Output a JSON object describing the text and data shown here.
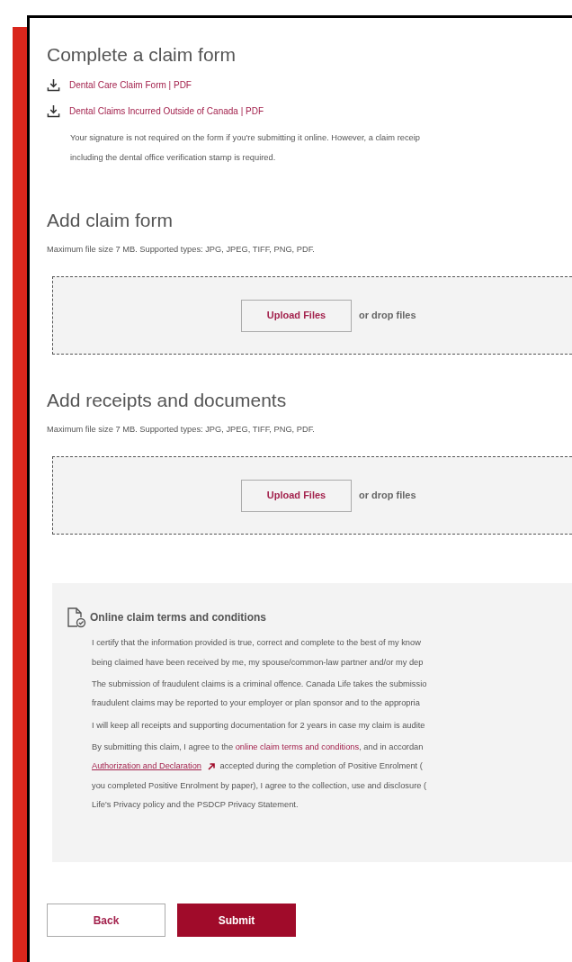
{
  "claim_form_section": {
    "heading": "Complete a claim form",
    "downloads": [
      {
        "label": "Dental Care Claim Form | PDF"
      },
      {
        "label": "Dental Claims Incurred Outside of Canada | PDF"
      }
    ],
    "note": [
      "Your signature is not required on the form if you're submitting it online. However, a claim receip",
      "including the dental office verification stamp is required."
    ]
  },
  "uploads": [
    {
      "heading": "Add claim form",
      "hint": "Maximum file size 7 MB. Supported types: JPG, JPEG, TIFF, PNG, PDF.",
      "button": "Upload Files",
      "drop_text": "or drop files"
    },
    {
      "heading": "Add receipts and documents",
      "hint": "Maximum file size 7 MB. Supported types: JPG, JPEG, TIFF, PNG, PDF.",
      "button": "Upload Files",
      "drop_text": "or drop files"
    }
  ],
  "terms": {
    "title": "Online claim terms and conditions",
    "paragraphs": [
      [
        {
          "kind": "text",
          "text": "I certify that the information provided is true, correct and complete to the best of my know\nbeing claimed have been received by me, my spouse/common-law partner and/or my dep"
        }
      ],
      [
        {
          "kind": "text",
          "text": "The submission of fraudulent claims is a criminal offence. Canada Life takes the submissio\nfraudulent claims may be reported to your employer or plan sponsor and to the appropria"
        }
      ],
      [
        {
          "kind": "text",
          "text": "I will keep all receipts and supporting documentation for 2 years in case my claim is audite"
        }
      ],
      [
        {
          "kind": "text",
          "text": "By submitting this claim, I agree to the "
        },
        {
          "kind": "link",
          "text": "online claim terms and conditions"
        },
        {
          "kind": "text",
          "text": ", and in accordan\n"
        },
        {
          "kind": "external_link",
          "text": "Authorization and Declaration"
        },
        {
          "kind": "text",
          "text": " accepted during the completion of Positive Enrolment (\nyou completed Positive Enrolment by paper), I agree to the collection, use and disclosure (\nLife's Privacy policy and the PSDCP Privacy Statement."
        }
      ]
    ]
  },
  "actions": {
    "back": "Back",
    "submit": "Submit"
  }
}
